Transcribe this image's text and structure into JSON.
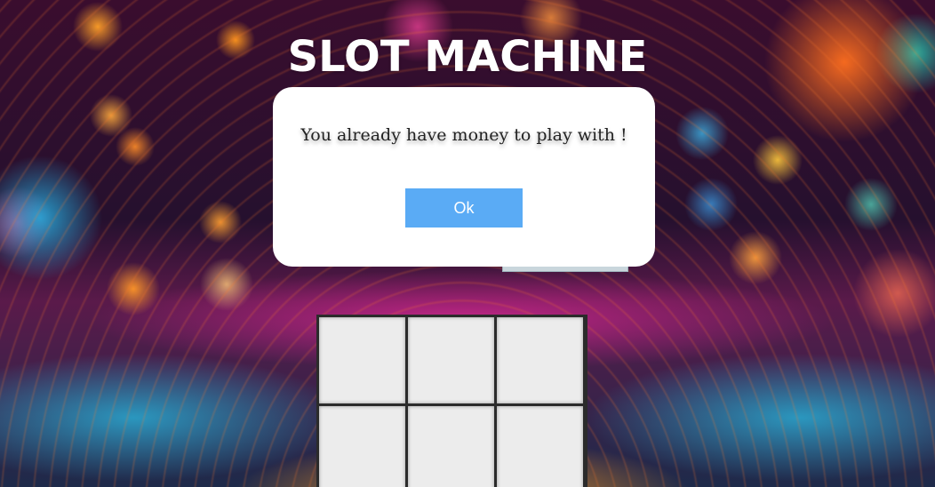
{
  "page": {
    "title": "SLOT MACHINE"
  },
  "modal": {
    "message": "You already have money to play with !",
    "ok_label": "Ok"
  },
  "slots": {
    "rows_visible": 2,
    "columns": 3
  },
  "colors": {
    "ok_button": "#5aabf5",
    "modal_background": "#ffffff",
    "slot_cell": "#ececec",
    "slot_frame": "#2b2b2b"
  }
}
